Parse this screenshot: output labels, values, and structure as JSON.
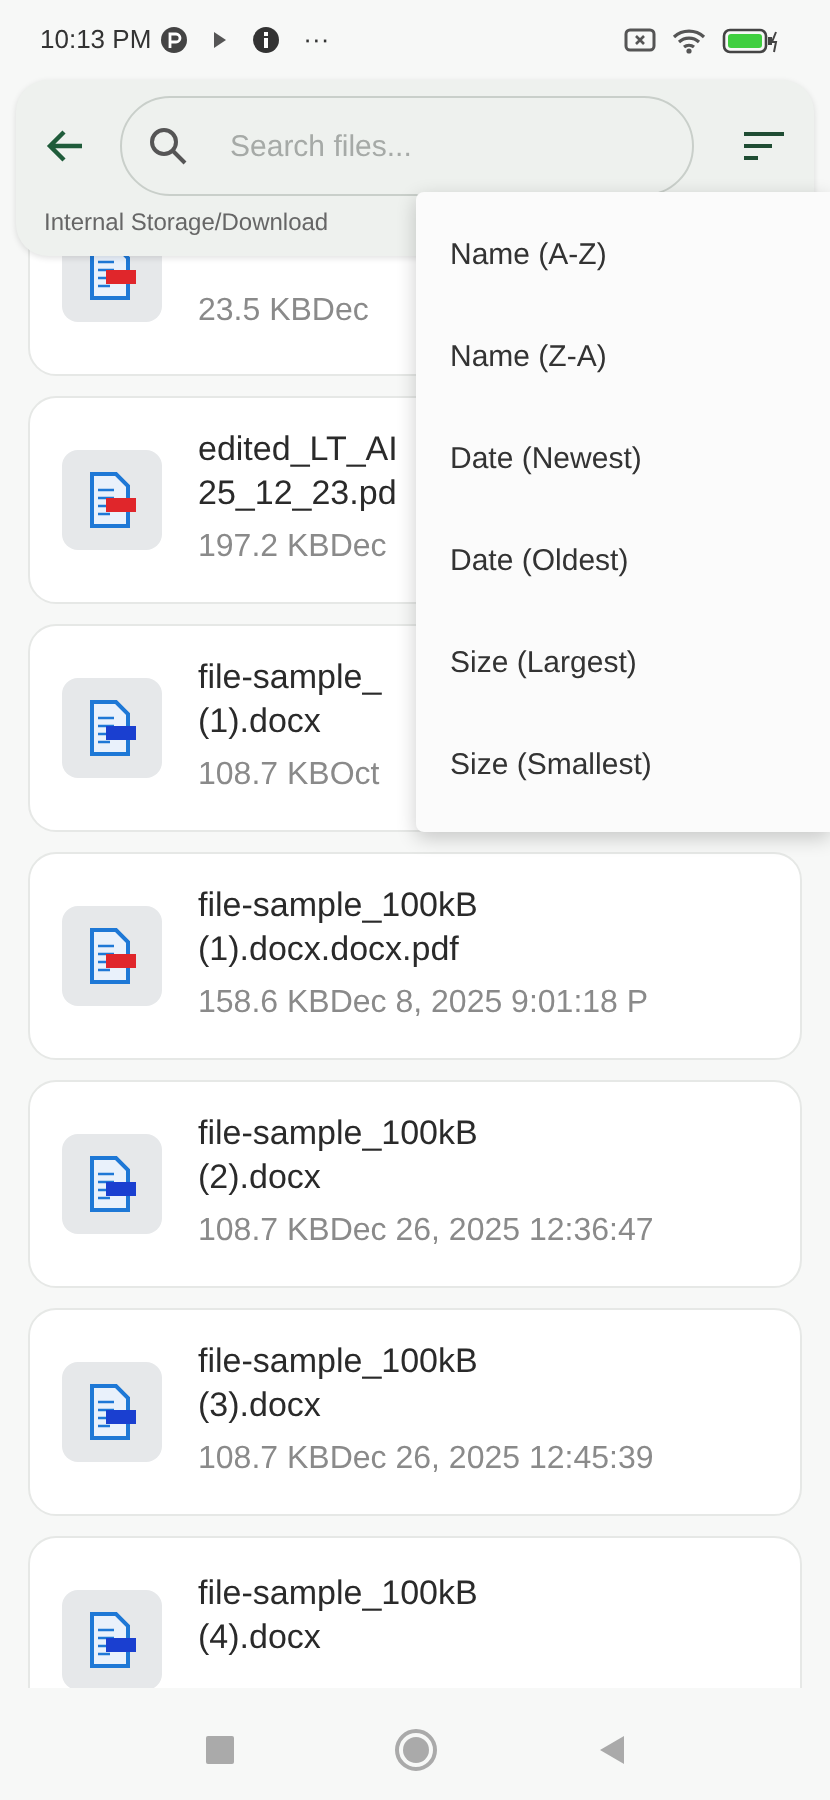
{
  "status_bar": {
    "time": "10:13 PM",
    "more": "···"
  },
  "header": {
    "search": {
      "placeholder": "Search files..."
    },
    "path": "Internal Storage/Download"
  },
  "files": [
    {
      "kind": "pdf",
      "meta": "23.5 KBDec"
    },
    {
      "kind": "pdf",
      "name": "edited_LT_AI\n25_12_23.pd",
      "meta": "197.2 KBDec"
    },
    {
      "kind": "docx",
      "name": "file-sample_\n(1).docx",
      "meta": "108.7 KBOct"
    },
    {
      "kind": "pdf",
      "name": "file-sample_100kB\n(1).docx.docx.pdf",
      "meta": "158.6 KBDec 8, 2025 9:01:18 P"
    },
    {
      "kind": "docx",
      "name": "file-sample_100kB\n(2).docx",
      "meta": "108.7 KBDec 26, 2025 12:36:47"
    },
    {
      "kind": "docx",
      "name": "file-sample_100kB\n(3).docx",
      "meta": "108.7 KBDec 26, 2025 12:45:39"
    },
    {
      "kind": "docx",
      "name": "file-sample_100kB\n(4).docx"
    }
  ],
  "sort_menu": [
    "Name (A-Z)",
    "Name (Z-A)",
    "Date (Newest)",
    "Date (Oldest)",
    "Size (Largest)",
    "Size (Smallest)"
  ]
}
